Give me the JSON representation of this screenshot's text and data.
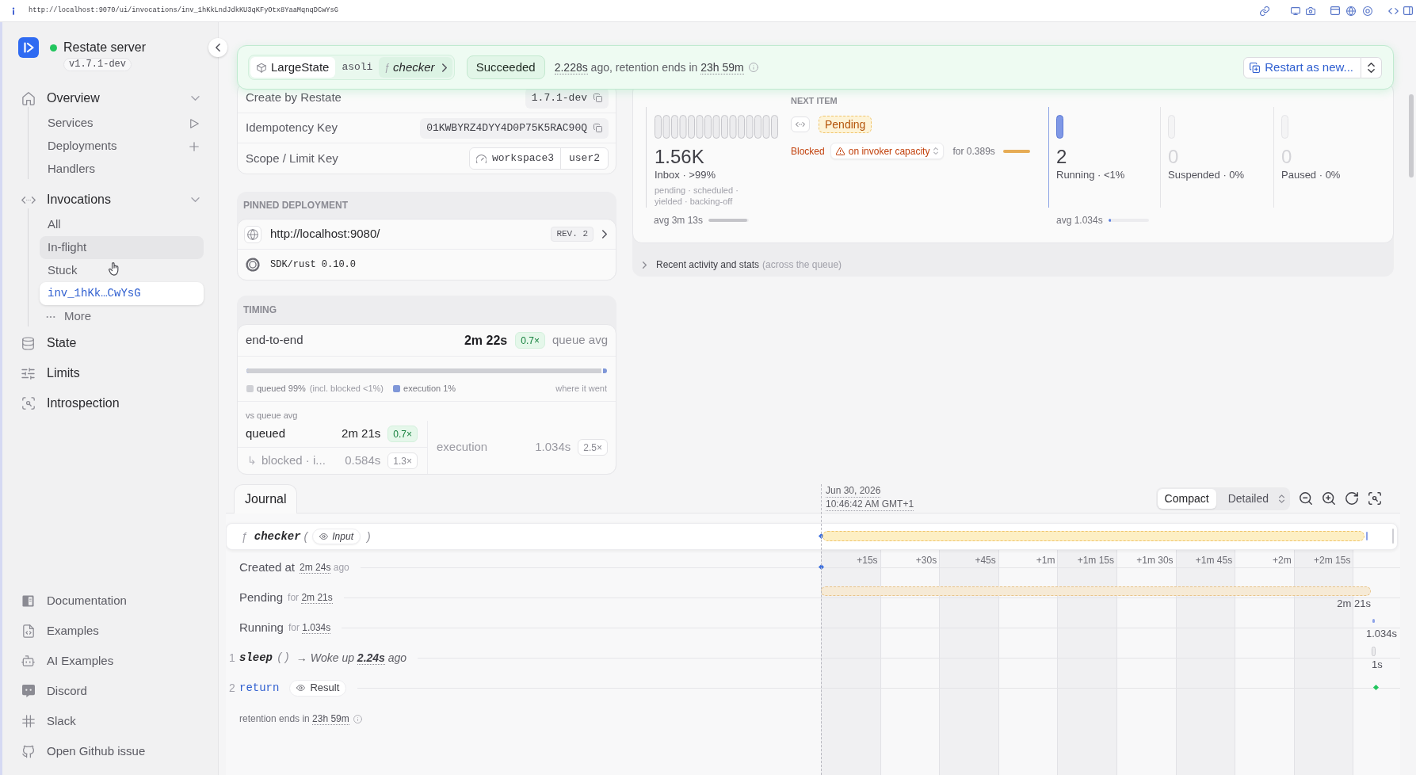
{
  "address_bar": {
    "url": "http://localhost:9070/ui/invocations/inv_1hKkLndJdkKU3qKFyOtx8YaaMqnqDCwYsG"
  },
  "sidebar": {
    "server": {
      "name": "Restate server",
      "version": "v1.7.1-dev",
      "online": true
    },
    "nav": [
      {
        "label": "Overview",
        "selected": false,
        "expanded": true,
        "children": [
          {
            "label": "Services",
            "kind": "link",
            "selected": false,
            "hovered": false
          },
          {
            "label": "Deployments",
            "kind": "link",
            "selected": false,
            "hovered": false
          },
          {
            "label": "Handlers",
            "kind": "link",
            "selected": false,
            "hovered": false
          }
        ]
      },
      {
        "label": "Invocations",
        "selected": false,
        "expanded": true,
        "children": [
          {
            "label": "All",
            "kind": "link",
            "selected": false,
            "hovered": false
          },
          {
            "label": "In-flight",
            "kind": "link",
            "selected": false,
            "hovered": true
          },
          {
            "label": "Stuck",
            "kind": "link",
            "selected": false,
            "hovered": false
          },
          {
            "label": "inv_1hKk…CwYsG",
            "kind": "invocation",
            "selected": true,
            "hovered": false
          },
          {
            "label": "More",
            "kind": "more",
            "selected": false,
            "hovered": false
          }
        ]
      },
      {
        "label": "State",
        "selected": false
      },
      {
        "label": "Limits",
        "selected": false
      },
      {
        "label": "Introspection",
        "selected": false
      }
    ],
    "links": [
      {
        "label": "Documentation"
      },
      {
        "label": "Examples"
      },
      {
        "label": "AI Examples"
      },
      {
        "label": "Discord"
      },
      {
        "label": "Slack"
      },
      {
        "label": "Open Github issue"
      }
    ]
  },
  "header": {
    "service": "LargeState",
    "key": "asoli",
    "handler_glyph": "ƒ",
    "handler": "checker",
    "status": "Succeeded",
    "success": true,
    "elapsed": "2.228s",
    "summary": "ago, retention ends in",
    "retention": "23h 59m",
    "restart": "Restart as new..."
  },
  "details": [
    {
      "label": "Create by Restate",
      "kind": "copy",
      "value": "1.7.1-dev"
    },
    {
      "label": "Idempotency Key",
      "kind": "copy",
      "value": "01KWBYRZ4DYY4D0P75K5RAC90Q"
    },
    {
      "label": "Scope / Limit Key",
      "kind": "scope",
      "scope": "workspace3",
      "limit_key": "user2"
    }
  ],
  "deployment": {
    "title": "PINNED DEPLOYMENT",
    "endpoint": "http://localhost:9080/",
    "revision": "REV. 2",
    "sdk": "SDK/rust 0.10.0"
  },
  "timing": {
    "title": "TIMING",
    "total": {
      "label": "end-to-end",
      "value": "2m 22s",
      "ratio": "0.7×",
      "better": true,
      "ratio_label": "queue avg"
    },
    "split": {
      "level": 0.99,
      "legend": [
        {
          "label": "queued 99%",
          "note": "(incl. blocked <1%)",
          "color": "#cfd0d5"
        },
        {
          "label": "execution 1%",
          "color": "#7f97d8"
        }
      ],
      "caption": "where it went"
    },
    "compare_title": "vs queue avg",
    "compare": [
      {
        "label": "queued",
        "value": "2m 21s",
        "ratio": "0.7×",
        "better": true,
        "dimmed": false
      },
      {
        "glyph": "↳",
        "label": "blocked · i...",
        "value": "0.584s",
        "ratio": "1.3×",
        "better": false,
        "dimmed": true
      }
    ],
    "execution": {
      "label": "execution",
      "value": "1.034s",
      "ratio": "2.5×",
      "better": false,
      "dimmed": true
    }
  },
  "queue": {
    "inbox": {
      "count": "1.56K",
      "label": "Inbox · >99%",
      "states": "pending · scheduled · yielded · backing-off",
      "avg": "avg 3m 13s",
      "level": 0.96
    },
    "next": {
      "title": "NEXT ITEM",
      "status": "Pending",
      "blocked": "Blocked",
      "reason": "on invoker capacity",
      "wait": "for 0.389s"
    },
    "counters": [
      {
        "count": "2",
        "label": "Running · <1%",
        "active": true,
        "avg": "avg 1.034s",
        "level": 0.04
      },
      {
        "count": "0",
        "label": "Suspended · 0%",
        "active": false
      },
      {
        "count": "0",
        "label": "Paused · 0%",
        "active": false
      }
    ],
    "recent": {
      "label": "Recent activity and stats",
      "note": "(across the queue)",
      "expanded": false
    }
  },
  "journal": {
    "tabs": [
      {
        "label": "Journal",
        "selected": true
      }
    ],
    "timeline": {
      "date": "Jun 30, 2026",
      "time": "10:46:42 AM GMT+1",
      "views": [
        {
          "label": "Compact",
          "selected": true
        },
        {
          "label": "Detailed",
          "selected": false
        }
      ],
      "ticks": [
        "+15s",
        "+30s",
        "+45s",
        "+1m",
        "+1m 15s",
        "+1m 30s",
        "+1m 45s",
        "+2m",
        "+2m 15s"
      ]
    },
    "entries": [
      {
        "kind": "call",
        "glyph": "ƒ",
        "name": "checker",
        "open": "(",
        "button": "Input",
        "close": ")"
      },
      {
        "kind": "start",
        "label": "Created at",
        "detail": "2m 24s",
        "suffix": "ago",
        "color": "#3b6fe0"
      },
      {
        "kind": "wait",
        "label": "Pending",
        "prefix": "for",
        "detail": "2m 21s",
        "bar_label": "2m 21s"
      },
      {
        "kind": "run",
        "label": "Running",
        "prefix": "for",
        "detail": "1.034s",
        "bar_label": "1.034s"
      },
      {
        "kind": "step",
        "index": "1",
        "name": "sleep",
        "parens": "()",
        "arrow": "→",
        "result": "Woke up",
        "detail": "2.24s",
        "suffix": "ago",
        "bar_label": "1s"
      },
      {
        "kind": "return",
        "index": "2",
        "name": "return",
        "button": "Result",
        "color": "#22c55e"
      }
    ],
    "retention": {
      "label": "retention ends in",
      "value": "23h 59m"
    }
  }
}
